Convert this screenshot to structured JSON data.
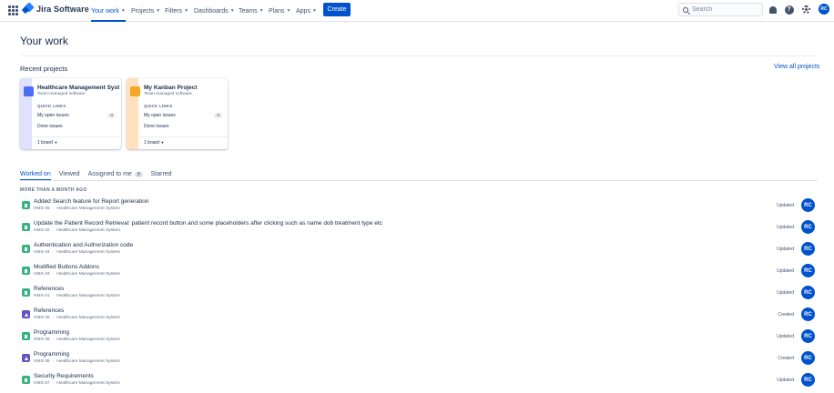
{
  "nav": {
    "logo_text": "Jira Software",
    "items": [
      {
        "label": "Your work",
        "active": true
      },
      {
        "label": "Projects"
      },
      {
        "label": "Filters"
      },
      {
        "label": "Dashboards"
      },
      {
        "label": "Teams"
      },
      {
        "label": "Plans"
      },
      {
        "label": "Apps"
      }
    ],
    "create_label": "Create",
    "search_placeholder": "Search",
    "user_initials": "RC"
  },
  "page": {
    "title": "Your work",
    "recent_projects_label": "Recent projects",
    "view_all_label": "View all projects"
  },
  "projects": [
    {
      "name": "Healthcare Management System",
      "type": "Team-managed software",
      "quick_links_label": "QUICK LINKS",
      "open_issues_label": "My open issues",
      "open_issues_count": "0",
      "done_issues_label": "Done issues",
      "boards_label": "1 board",
      "stripe_color": "#dfe1ff",
      "icon_color": "#4c6ef5"
    },
    {
      "name": "My Kanban Project",
      "type": "Team-managed software",
      "quick_links_label": "QUICK LINKS",
      "open_issues_label": "My open issues",
      "open_issues_count": "0",
      "done_issues_label": "Done issues",
      "boards_label": "1 board",
      "stripe_color": "#ffe2bd",
      "icon_color": "#f5a623"
    }
  ],
  "tabs": [
    {
      "label": "Worked on",
      "active": true
    },
    {
      "label": "Viewed"
    },
    {
      "label": "Assigned to me",
      "badge": "0"
    },
    {
      "label": "Starred"
    }
  ],
  "section_label": "MORE THAN A MONTH AGO",
  "activity": [
    {
      "title": "Added Search feature for Report generation",
      "key": "HMS-45",
      "project": "Healthcare Management System",
      "status": "Updated",
      "type": "story"
    },
    {
      "title": "Update the Patient Record Retrieval: patient record button and some placeholders after clicking such as name dob treatment type etc",
      "key": "HMS-42",
      "project": "Healthcare Management System",
      "status": "Updated",
      "type": "story"
    },
    {
      "title": "Authentication and Authorization code",
      "key": "HMS-44",
      "project": "Healthcare Management System",
      "status": "Updated",
      "type": "story"
    },
    {
      "title": "Modified Buttons Addons",
      "key": "HMS-43",
      "project": "Healthcare Management System",
      "status": "Updated",
      "type": "story"
    },
    {
      "title": "References",
      "key": "HMS-41",
      "project": "Healthcare Management System",
      "status": "Updated",
      "type": "story"
    },
    {
      "title": "References",
      "key": "HMS-40",
      "project": "Healthcare Management System",
      "status": "Created",
      "type": "epic"
    },
    {
      "title": "Programming",
      "key": "HMS-39",
      "project": "Healthcare Management System",
      "status": "Updated",
      "type": "story"
    },
    {
      "title": "Programming",
      "key": "HMS-38",
      "project": "Healthcare Management System",
      "status": "Created",
      "type": "epic"
    },
    {
      "title": "Security Requirements",
      "key": "HMS-37",
      "project": "Healthcare Management System",
      "status": "Updated",
      "type": "story"
    }
  ],
  "colors": {
    "accent": "#0052cc",
    "story": "#36b37e",
    "epic": "#6554c0"
  }
}
